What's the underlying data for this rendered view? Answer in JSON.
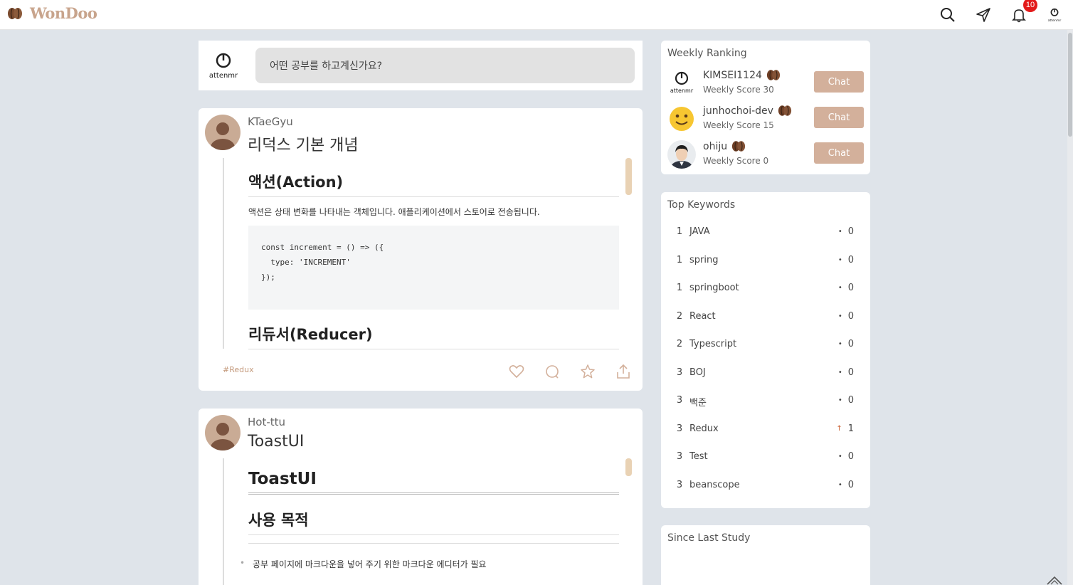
{
  "app": {
    "name": "WonDoo",
    "notification_count": "10"
  },
  "nav": {
    "icons": [
      "search-icon",
      "send-icon",
      "bell-icon",
      "profile-icon"
    ]
  },
  "compose": {
    "placeholder": "어떤 공부를 하고계신가요?",
    "avatar_text": "attenmr"
  },
  "posts": [
    {
      "author": "KTaeGyu",
      "title": "리덕스 기본 개념",
      "h1": "액션(Action)",
      "para": "액션은 상태 변화를 나타내는 객체입니다. 애플리케이션에서 스토어로 전송됩니다.",
      "code": "const increment = () => ({\n  type: 'INCREMENT'\n});",
      "h2": "리듀서(Reducer)",
      "tag": "#Redux"
    },
    {
      "author": "Hot-ttu",
      "title": "ToastUI",
      "h1": "ToastUI",
      "h2": "사용 목적",
      "bullet": "공부 페이지에 마크다운을 넣어 주기 위한 마크다운 에디터가 필요"
    }
  ],
  "weekly_ranking": {
    "title": "Weekly Ranking",
    "chat_label": "Chat",
    "items": [
      {
        "name": "KIMSEI1124",
        "score": "Weekly Score 30",
        "avatar": "logo"
      },
      {
        "name": "junhochoi-dev",
        "score": "Weekly Score 15",
        "avatar": "smiley"
      },
      {
        "name": "ohiju",
        "score": "Weekly Score 0",
        "avatar": "photo"
      }
    ]
  },
  "top_keywords": {
    "title": "Top Keywords",
    "items": [
      {
        "rank": "1",
        "word": "JAVA",
        "change": "0",
        "trend": "same"
      },
      {
        "rank": "1",
        "word": "spring",
        "change": "0",
        "trend": "same"
      },
      {
        "rank": "1",
        "word": "springboot",
        "change": "0",
        "trend": "same"
      },
      {
        "rank": "2",
        "word": "React",
        "change": "0",
        "trend": "same"
      },
      {
        "rank": "2",
        "word": "Typescript",
        "change": "0",
        "trend": "same"
      },
      {
        "rank": "3",
        "word": "BOJ",
        "change": "0",
        "trend": "same"
      },
      {
        "rank": "3",
        "word": "백준",
        "change": "0",
        "trend": "same"
      },
      {
        "rank": "3",
        "word": "Redux",
        "change": "1",
        "trend": "up"
      },
      {
        "rank": "3",
        "word": "Test",
        "change": "0",
        "trend": "same"
      },
      {
        "rank": "3",
        "word": "beanscope",
        "change": "0",
        "trend": "same"
      }
    ]
  },
  "since_last_study": {
    "title": "Since Last Study"
  },
  "colors": {
    "brand": "#c8a48c",
    "chat_button": "#d3b09b",
    "badge": "#e31b1b",
    "background": "#dfe4ea"
  }
}
